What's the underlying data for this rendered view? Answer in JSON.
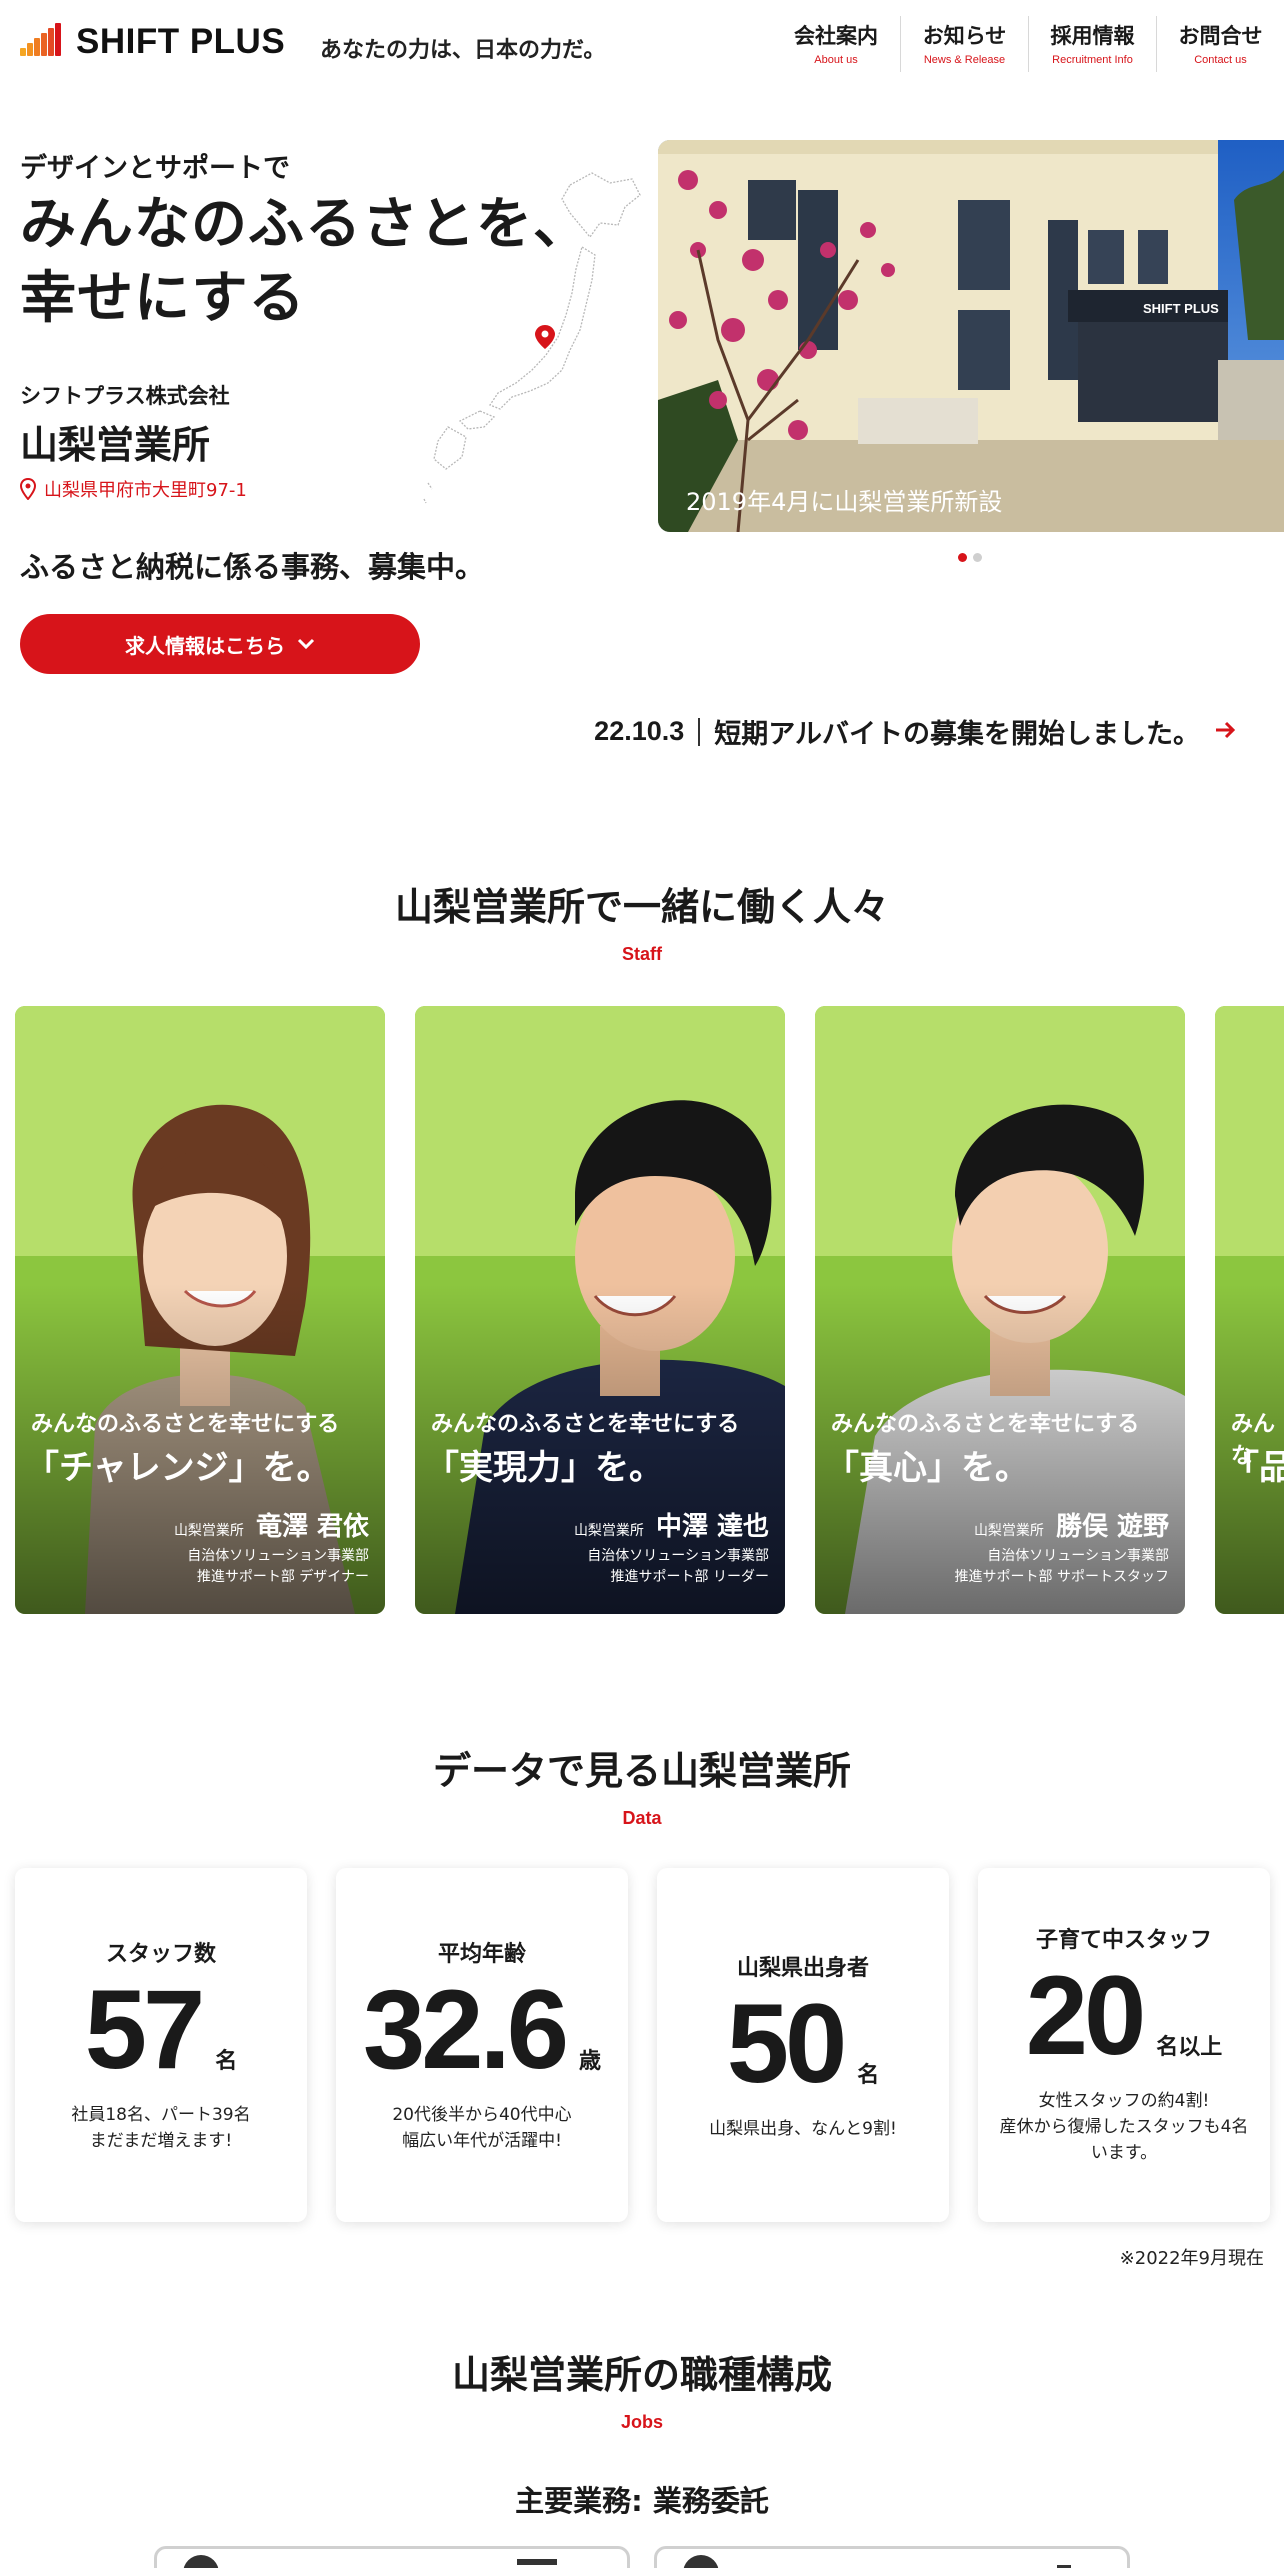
{
  "header": {
    "logo": "SHIFT PLUS",
    "tagline": "あなたの力は、日本の力だ。",
    "nav": [
      {
        "jp": "会社案内",
        "en": "About us"
      },
      {
        "jp": "お知らせ",
        "en": "News & Release"
      },
      {
        "jp": "採用情報",
        "en": "Recruitment Info"
      },
      {
        "jp": "お問合せ",
        "en": "Contact us"
      }
    ]
  },
  "hero": {
    "sub": "デザインとサポートで",
    "title_line1": "みんなのふるさとを、",
    "title_line2": "幸せにする",
    "company": "シフトプラス株式会社",
    "office": "山梨営業所",
    "address": "山梨県甲府市大里町97-1",
    "recruit": "ふるさと納税に係る事務、募集中。",
    "cta": "求人情報はこちら",
    "photo_caption": "2019年4月に山梨営業所新設",
    "photo_sign": "SHIFT PLUS"
  },
  "news": {
    "date": "22.10.3",
    "text": "短期アルバイトの募集を開始しました。"
  },
  "staff_section": {
    "title": "山梨営業所で一緒に働く人々",
    "sub": "Staff",
    "cards": [
      {
        "lead": "みんなのふるさとを幸せにする",
        "quote": "「チャレンジ」を。",
        "office": "山梨営業所",
        "name": "竜澤 君依",
        "dept1": "自治体ソリューション事業部",
        "dept2": "推進サポート部 デザイナー"
      },
      {
        "lead": "みんなのふるさとを幸せにする",
        "quote": "「実現力」を。",
        "office": "山梨営業所",
        "name": "中澤 達也",
        "dept1": "自治体ソリューション事業部",
        "dept2": "推進サポート部 リーダー"
      },
      {
        "lead": "みんなのふるさとを幸せにする",
        "quote": "「真心」を。",
        "office": "山梨営業所",
        "name": "勝俣 遊野",
        "dept1": "自治体ソリューション事業部",
        "dept2": "推進サポート部 サポートスタッフ"
      },
      {
        "lead": "みんな",
        "quote": "「品"
      }
    ]
  },
  "data_section": {
    "title": "データで見る山梨営業所",
    "sub": "Data",
    "cards": [
      {
        "label": "スタッフ数",
        "num": "57",
        "unit": "名",
        "note1": "社員18名、パート39名",
        "note2": "まだまだ増えます!"
      },
      {
        "label": "平均年齢",
        "num": "32.6",
        "unit": "歳",
        "note1": "20代後半から40代中心",
        "note2": "幅広い年代が活躍中!"
      },
      {
        "label": "山梨県出身者",
        "num": "50",
        "unit": "名",
        "note1": "山梨県出身、なんと9割!",
        "note2": ""
      },
      {
        "label": "子育て中スタッフ",
        "num": "20",
        "unit": "名以上",
        "note1": "女性スタッフの約4割!",
        "note2": "産休から復帰したスタッフも4名います。"
      }
    ],
    "asof": "※2022年9月現在"
  },
  "jobs_section": {
    "title": "山梨営業所の職種構成",
    "sub": "Jobs",
    "main": "主要業務: 業務委託"
  },
  "colors": {
    "accent": "#d7141a"
  }
}
